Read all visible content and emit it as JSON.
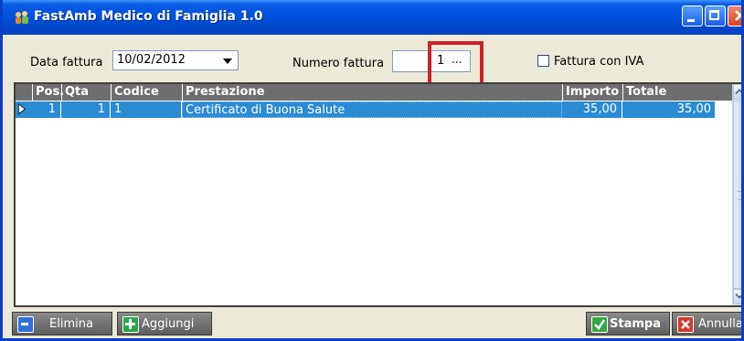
{
  "window": {
    "title": "FastAmb Medico di Famiglia 1.0",
    "icon": "people-icon"
  },
  "controls": {
    "minimize": "minimize-icon",
    "maximize": "maximize-icon",
    "close": "close-icon"
  },
  "form": {
    "data_fattura_label": "Data fattura",
    "data_fattura_value": "10/02/2012",
    "numero_fattura_label": "Numero fattura",
    "numero_fattura_value": "1",
    "numero_fattura_ellipsis": "...",
    "fattura_con_iva_label": "Fattura con IVA",
    "fattura_con_iva_checked": false
  },
  "grid": {
    "columns": [
      "Pos.",
      "Qta",
      "Codice",
      "Prestazione",
      "Importo",
      "Totale"
    ],
    "rows": [
      {
        "pos": "1",
        "qta": "1",
        "codice": "1",
        "prestazione": "Certificato di Buona Salute",
        "importo": "35,00",
        "totale": "35,00"
      }
    ]
  },
  "buttons": {
    "elimina": "Elimina",
    "aggiungi": "Aggiungi",
    "stampa": "Stampa",
    "annulla": "Annulla"
  },
  "colors": {
    "titlebar": "#0052e0",
    "header": "#6e6e6e",
    "selection": "#2b8bd3",
    "highlight": "#d01f2b"
  }
}
